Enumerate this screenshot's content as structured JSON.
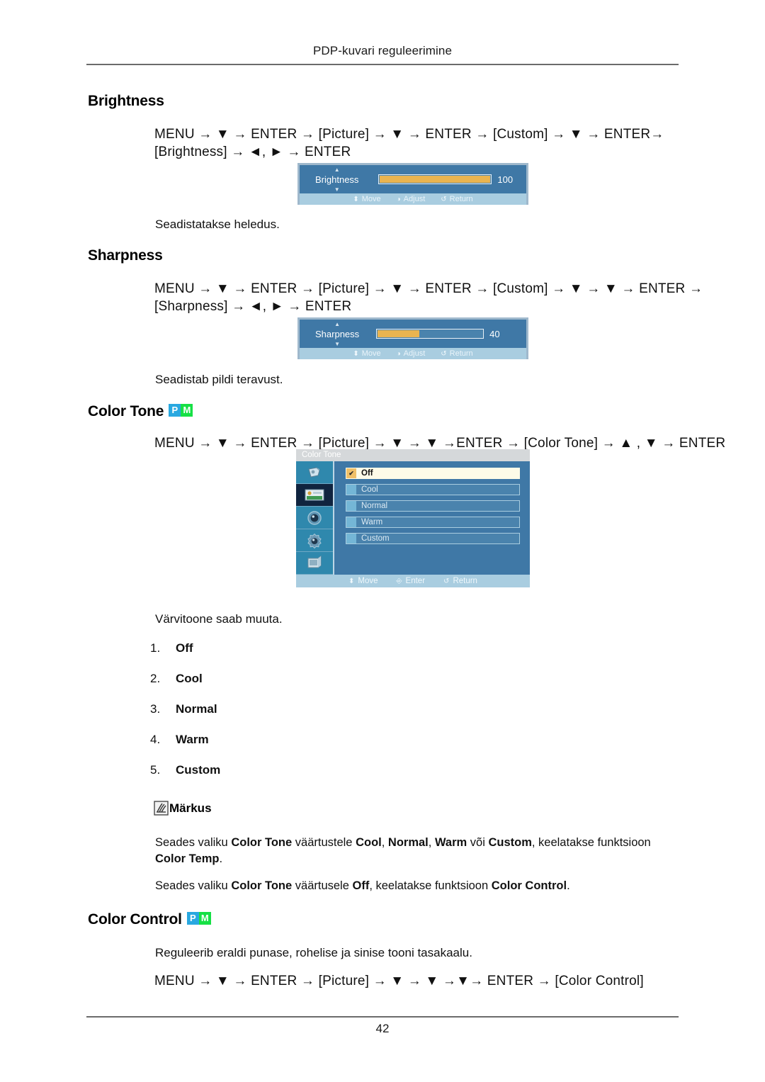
{
  "header": {
    "title": "PDP-kuvari reguleerimine"
  },
  "footer": {
    "page_number": "42"
  },
  "badges": {
    "p": "P",
    "m": "M"
  },
  "sections": {
    "brightness": {
      "heading": "Brightness",
      "navpath_line1": "MENU → ▼ → ENTER → [Picture] → ▼ → ENTER → [Custom] → ▼ → ENTER→",
      "navpath_line2": "[Brightness] → ◄, ► → ENTER",
      "description": "Seadistatakse heledus.",
      "osd": {
        "label": "Brightness",
        "value": "100",
        "fill_percent": 100,
        "hints": {
          "move": "Move",
          "adjust": "Adjust",
          "return": "Return"
        }
      }
    },
    "sharpness": {
      "heading": "Sharpness",
      "navpath_line1": "MENU → ▼ → ENTER → [Picture] → ▼ → ENTER → [Custom] → ▼ → ▼ → ENTER →",
      "navpath_line2": "[Sharpness] → ◄, ► → ENTER",
      "description": "Seadistab pildi teravust.",
      "osd": {
        "label": "Sharpness",
        "value": "40",
        "fill_percent": 40,
        "hints": {
          "move": "Move",
          "adjust": "Adjust",
          "return": "Return"
        }
      }
    },
    "color_tone": {
      "heading": "Color Tone",
      "navpath_line1": "MENU → ▼ → ENTER → [Picture] → ▼ → ▼ →ENTER → [Color Tone] → ▲ , ▼ → ENTER",
      "description": "Värvitoone saab muuta.",
      "osd": {
        "title": "Color Tone",
        "options": [
          {
            "label": "Off",
            "selected": true
          },
          {
            "label": "Cool",
            "selected": false
          },
          {
            "label": "Normal",
            "selected": false
          },
          {
            "label": "Warm",
            "selected": false
          },
          {
            "label": "Custom",
            "selected": false
          }
        ],
        "rail_icons": [
          "input-source-icon",
          "picture-icon",
          "sound-icon",
          "setup-icon",
          "multi-control-icon"
        ],
        "active_rail_index": 1,
        "hints": {
          "move": "Move",
          "enter": "Enter",
          "return": "Return"
        }
      },
      "list": [
        {
          "num": "1.",
          "value": "Off"
        },
        {
          "num": "2.",
          "value": "Cool"
        },
        {
          "num": "3.",
          "value": "Normal"
        },
        {
          "num": "4.",
          "value": "Warm"
        },
        {
          "num": "5.",
          "value": "Custom"
        }
      ]
    },
    "note": {
      "label": "Märkus",
      "paragraph1_html": "Seades valiku <b>Color Tone</b> väärtustele <b>Cool</b>, <b>Normal</b>, <b>Warm</b> või <b>Custom</b>, keelatakse funktsioon <b>Color Temp</b>.",
      "paragraph2_html": "Seades valiku <b>Color Tone</b> väärtusele <b>Off</b>, keelatakse funktsioon <b>Color Control</b>."
    },
    "color_control": {
      "heading": "Color Control",
      "description": "Reguleerib eraldi punase, rohelise ja sinise tooni tasakaalu.",
      "navpath_line1": "MENU → ▼ → ENTER → [Picture] → ▼ → ▼ →▼→ ENTER → [Color Control]"
    }
  },
  "colors": {
    "badge_p": "#29a8e0",
    "badge_m": "#16e045",
    "osd_body": "#3f78a6",
    "osd_bottom_bar": "#a9cde0",
    "slider_fill": "#e9b450",
    "rail_active": "#10243f",
    "selected_row": "#fdfbe8"
  }
}
